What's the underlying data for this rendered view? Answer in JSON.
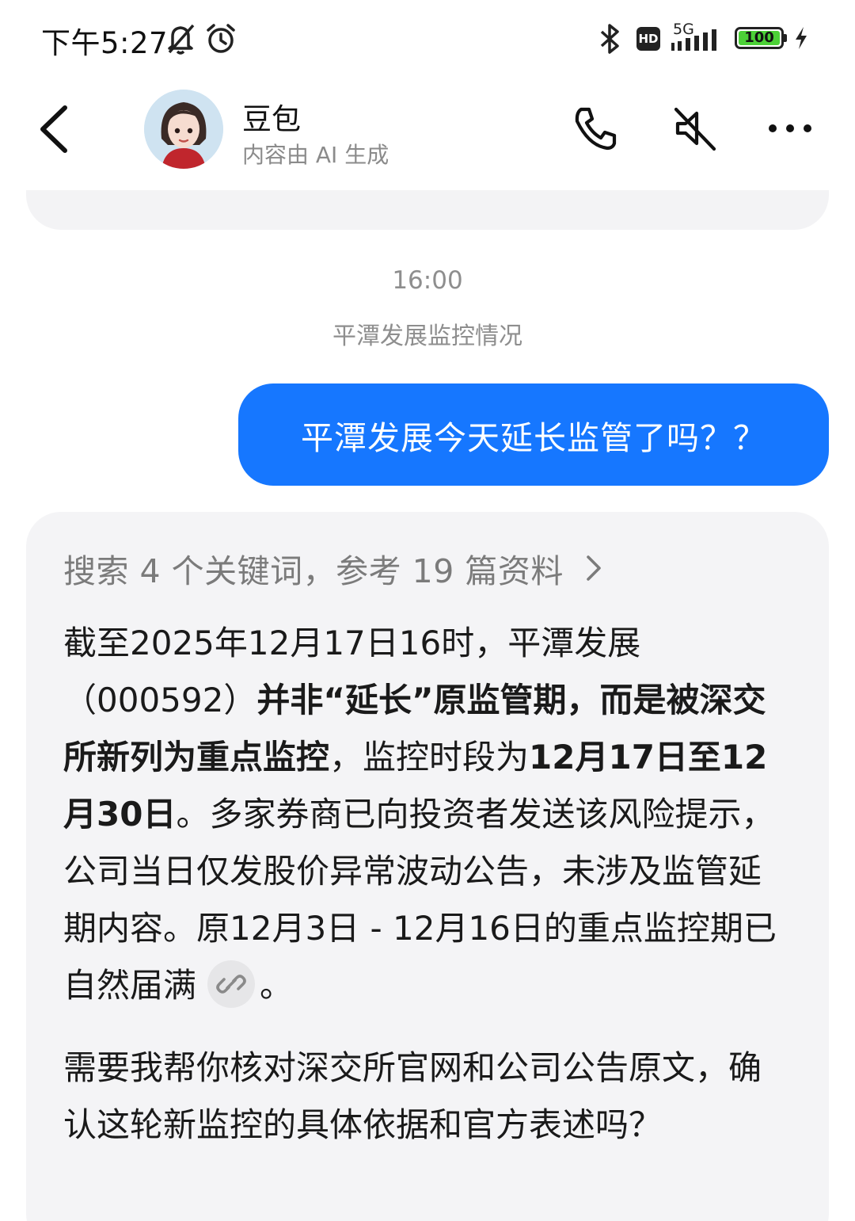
{
  "status_bar": {
    "time": "下午5:27",
    "network": "5G",
    "hd_label": "HD",
    "battery": "100"
  },
  "header": {
    "name": "豆包",
    "subtitle": "内容由 AI 生成"
  },
  "chat": {
    "timestamp": "16:00",
    "topic": "平潭发展监控情况",
    "user_message": "平潭发展今天延长监管了吗？？",
    "search_summary": "搜索 4 个关键词，参考 19 篇资料",
    "answer": {
      "t1": "截至2025年12月17日16时，平潭发展（000592）",
      "b1": "并非“延长”原监管期，而是被深交所新列为重点监控",
      "t2": "，监控时段为",
      "b2": "12月17日至12月30日",
      "t3": "。多家券商已向投资者发送该风险提示，公司当日仅发股价异常波动公告，未涉及监管延期内容。原12月3日 - 12月16日的重点监控期已自然届满",
      "t4": "。"
    },
    "followup": "需要我帮你核对深交所官网和公司公告原文，确认这轮新监控的具体依据和官方表述吗？"
  }
}
